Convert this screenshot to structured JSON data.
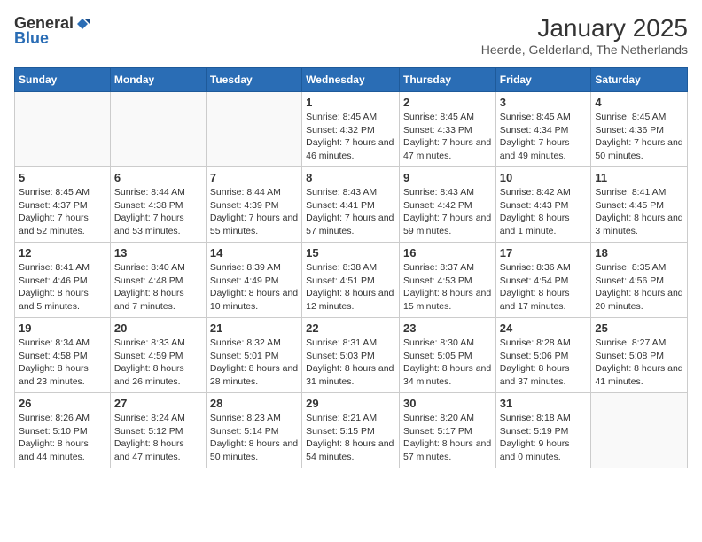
{
  "logo": {
    "general": "General",
    "blue": "Blue"
  },
  "title": {
    "month_year": "January 2025",
    "location": "Heerde, Gelderland, The Netherlands"
  },
  "weekdays": [
    "Sunday",
    "Monday",
    "Tuesday",
    "Wednesday",
    "Thursday",
    "Friday",
    "Saturday"
  ],
  "weeks": [
    [
      {
        "day": "",
        "info": ""
      },
      {
        "day": "",
        "info": ""
      },
      {
        "day": "",
        "info": ""
      },
      {
        "day": "1",
        "info": "Sunrise: 8:45 AM\nSunset: 4:32 PM\nDaylight: 7 hours and 46 minutes."
      },
      {
        "day": "2",
        "info": "Sunrise: 8:45 AM\nSunset: 4:33 PM\nDaylight: 7 hours and 47 minutes."
      },
      {
        "day": "3",
        "info": "Sunrise: 8:45 AM\nSunset: 4:34 PM\nDaylight: 7 hours and 49 minutes."
      },
      {
        "day": "4",
        "info": "Sunrise: 8:45 AM\nSunset: 4:36 PM\nDaylight: 7 hours and 50 minutes."
      }
    ],
    [
      {
        "day": "5",
        "info": "Sunrise: 8:45 AM\nSunset: 4:37 PM\nDaylight: 7 hours and 52 minutes."
      },
      {
        "day": "6",
        "info": "Sunrise: 8:44 AM\nSunset: 4:38 PM\nDaylight: 7 hours and 53 minutes."
      },
      {
        "day": "7",
        "info": "Sunrise: 8:44 AM\nSunset: 4:39 PM\nDaylight: 7 hours and 55 minutes."
      },
      {
        "day": "8",
        "info": "Sunrise: 8:43 AM\nSunset: 4:41 PM\nDaylight: 7 hours and 57 minutes."
      },
      {
        "day": "9",
        "info": "Sunrise: 8:43 AM\nSunset: 4:42 PM\nDaylight: 7 hours and 59 minutes."
      },
      {
        "day": "10",
        "info": "Sunrise: 8:42 AM\nSunset: 4:43 PM\nDaylight: 8 hours and 1 minute."
      },
      {
        "day": "11",
        "info": "Sunrise: 8:41 AM\nSunset: 4:45 PM\nDaylight: 8 hours and 3 minutes."
      }
    ],
    [
      {
        "day": "12",
        "info": "Sunrise: 8:41 AM\nSunset: 4:46 PM\nDaylight: 8 hours and 5 minutes."
      },
      {
        "day": "13",
        "info": "Sunrise: 8:40 AM\nSunset: 4:48 PM\nDaylight: 8 hours and 7 minutes."
      },
      {
        "day": "14",
        "info": "Sunrise: 8:39 AM\nSunset: 4:49 PM\nDaylight: 8 hours and 10 minutes."
      },
      {
        "day": "15",
        "info": "Sunrise: 8:38 AM\nSunset: 4:51 PM\nDaylight: 8 hours and 12 minutes."
      },
      {
        "day": "16",
        "info": "Sunrise: 8:37 AM\nSunset: 4:53 PM\nDaylight: 8 hours and 15 minutes."
      },
      {
        "day": "17",
        "info": "Sunrise: 8:36 AM\nSunset: 4:54 PM\nDaylight: 8 hours and 17 minutes."
      },
      {
        "day": "18",
        "info": "Sunrise: 8:35 AM\nSunset: 4:56 PM\nDaylight: 8 hours and 20 minutes."
      }
    ],
    [
      {
        "day": "19",
        "info": "Sunrise: 8:34 AM\nSunset: 4:58 PM\nDaylight: 8 hours and 23 minutes."
      },
      {
        "day": "20",
        "info": "Sunrise: 8:33 AM\nSunset: 4:59 PM\nDaylight: 8 hours and 26 minutes."
      },
      {
        "day": "21",
        "info": "Sunrise: 8:32 AM\nSunset: 5:01 PM\nDaylight: 8 hours and 28 minutes."
      },
      {
        "day": "22",
        "info": "Sunrise: 8:31 AM\nSunset: 5:03 PM\nDaylight: 8 hours and 31 minutes."
      },
      {
        "day": "23",
        "info": "Sunrise: 8:30 AM\nSunset: 5:05 PM\nDaylight: 8 hours and 34 minutes."
      },
      {
        "day": "24",
        "info": "Sunrise: 8:28 AM\nSunset: 5:06 PM\nDaylight: 8 hours and 37 minutes."
      },
      {
        "day": "25",
        "info": "Sunrise: 8:27 AM\nSunset: 5:08 PM\nDaylight: 8 hours and 41 minutes."
      }
    ],
    [
      {
        "day": "26",
        "info": "Sunrise: 8:26 AM\nSunset: 5:10 PM\nDaylight: 8 hours and 44 minutes."
      },
      {
        "day": "27",
        "info": "Sunrise: 8:24 AM\nSunset: 5:12 PM\nDaylight: 8 hours and 47 minutes."
      },
      {
        "day": "28",
        "info": "Sunrise: 8:23 AM\nSunset: 5:14 PM\nDaylight: 8 hours and 50 minutes."
      },
      {
        "day": "29",
        "info": "Sunrise: 8:21 AM\nSunset: 5:15 PM\nDaylight: 8 hours and 54 minutes."
      },
      {
        "day": "30",
        "info": "Sunrise: 8:20 AM\nSunset: 5:17 PM\nDaylight: 8 hours and 57 minutes."
      },
      {
        "day": "31",
        "info": "Sunrise: 8:18 AM\nSunset: 5:19 PM\nDaylight: 9 hours and 0 minutes."
      },
      {
        "day": "",
        "info": ""
      }
    ]
  ]
}
